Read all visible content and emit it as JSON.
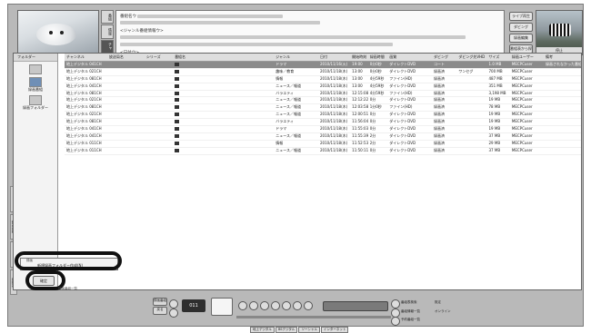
{
  "top": {
    "info_lines": [
      "番組名ウ",
      "",
      "<ジャンル番組情報ウ>",
      "",
      "",
      "<日付ウ>"
    ],
    "vertical_tabs": [
      "番組",
      "情報",
      "チャ"
    ],
    "side_buttons": [
      "ライブ再生",
      "ダビング",
      "録画編集",
      "番組表から探す",
      "削除"
    ],
    "preview_caption": "停止"
  },
  "folders": {
    "header": "フォルダー",
    "items": [
      "",
      "録画番組",
      "録画フォルダー"
    ]
  },
  "list": {
    "columns": [
      "チャンネル",
      "放送局名",
      "シリーズ",
      "番組名",
      "ジャンル",
      "日付",
      "開始時刻",
      "録画時間",
      "画質",
      "ダビング",
      "ダビング先VHD",
      "サイズ",
      "録画ユーザー",
      "備考"
    ],
    "rows": [
      [
        "地上デジタル 041CH",
        "",
        "",
        "",
        "ドラマ",
        "2010/11/16(火)",
        "19:00",
        "0分0秒",
        "ダイレクトDVD",
        "コート",
        "",
        "1.0 MB",
        "MECPCuser",
        "録画されなかった番組"
      ],
      [
        "地上デジタル 021CH",
        "",
        "",
        "",
        "趣味／教育",
        "2010/11/18(木)",
        "13:00",
        "0分0秒",
        "ダイレクトDVD",
        "録画済",
        "ワンセグ",
        "700 MB",
        "MECPCuser",
        ""
      ],
      [
        "地上デジタル 081CH",
        "",
        "",
        "",
        "情報",
        "2010/11/18(木)",
        "13:00",
        "4分59秒",
        "ファイン(HD)",
        "録画済",
        "",
        "487 MB",
        "MECPCuser",
        ""
      ],
      [
        "地上デジタル 041CH",
        "",
        "",
        "",
        "ニュース／報道",
        "2010/11/18(木)",
        "13:00",
        "4分59秒",
        "ダイレクトDVD",
        "録画済",
        "",
        "351 MB",
        "MECPCuser",
        ""
      ],
      [
        "地上デジタル 081CH",
        "",
        "",
        "",
        "バラエティ",
        "2010/11/18(木)",
        "12:15:08",
        "4分59秒",
        "ファイン(HD)",
        "録画済",
        "",
        "3,198 MB",
        "MECPCuser",
        ""
      ],
      [
        "地上デジタル 021CH",
        "",
        "",
        "",
        "ニュース／報道",
        "2010/11/18(木)",
        "12:12:22",
        "0分",
        "ダイレクトDVD",
        "録画済",
        "",
        "19 MB",
        "MECPCuser",
        ""
      ],
      [
        "地上デジタル 081CH",
        "",
        "",
        "",
        "ニュース／報道",
        "2010/11/18(木)",
        "12:03:58",
        "1分0秒",
        "ファイン(HD)",
        "録画済",
        "",
        "78 MB",
        "MECPCuser",
        ""
      ],
      [
        "地上デジタル 021CH",
        "",
        "",
        "",
        "ニュース／報道",
        "2010/11/18(木)",
        "12:00:51",
        "0分",
        "ダイレクトDVD",
        "録画済",
        "",
        "19 MB",
        "MECPCuser",
        ""
      ],
      [
        "地上デジタル 081CH",
        "",
        "",
        "",
        "バラエティ",
        "2010/11/18(木)",
        "11:56:04",
        "0分",
        "ダイレクトDVD",
        "録画済",
        "",
        "19 MB",
        "MECPCuser",
        ""
      ],
      [
        "地上デジタル 041CH",
        "",
        "",
        "",
        "ドラマ",
        "2010/11/18(木)",
        "11:55:03",
        "0分",
        "ダイレクトDVD",
        "録画済",
        "",
        "19 MB",
        "MECPCuser",
        ""
      ],
      [
        "地上デジタル 041CH",
        "",
        "",
        "",
        "ニュース／報道",
        "2010/11/18(木)",
        "11:55:39",
        "2分",
        "ダイレクトDVD",
        "録画済",
        "",
        "37 MB",
        "MECPCuser",
        ""
      ],
      [
        "地上デジタル 011CH",
        "",
        "",
        "",
        "情報",
        "2010/11/18(木)",
        "11:52:53",
        "2分",
        "ダイレクトDVD",
        "録画済",
        "",
        "29 MB",
        "MECPCuser",
        ""
      ],
      [
        "地上デジタル 011CH",
        "",
        "",
        "",
        "ニュース／報道",
        "2010/11/18(木)",
        "11:50:11",
        "0分",
        "ダイレクトDVD",
        "録画済",
        "",
        "37 MB",
        "MECPCuser",
        ""
      ]
    ]
  },
  "left_strip": [
    "",
    "録画番組",
    "",
    "番組表"
  ],
  "popup": {
    "title": "録画",
    "item": "新規録画フォルダー作成(N)"
  },
  "ok_button": "確定",
  "cancel_label": "録画番組一覧",
  "transport": {
    "clock": "011",
    "buttons_left": [
      "録画番組",
      "戻る"
    ],
    "right_labels": [
      "番組表検索",
      "番組情報一覧",
      "予約番組一覧",
      "既定",
      "オンライン"
    ]
  },
  "status_tabs": [
    "地上デジタル",
    "BSデジタル",
    "ソーシャル",
    "インターネット"
  ]
}
